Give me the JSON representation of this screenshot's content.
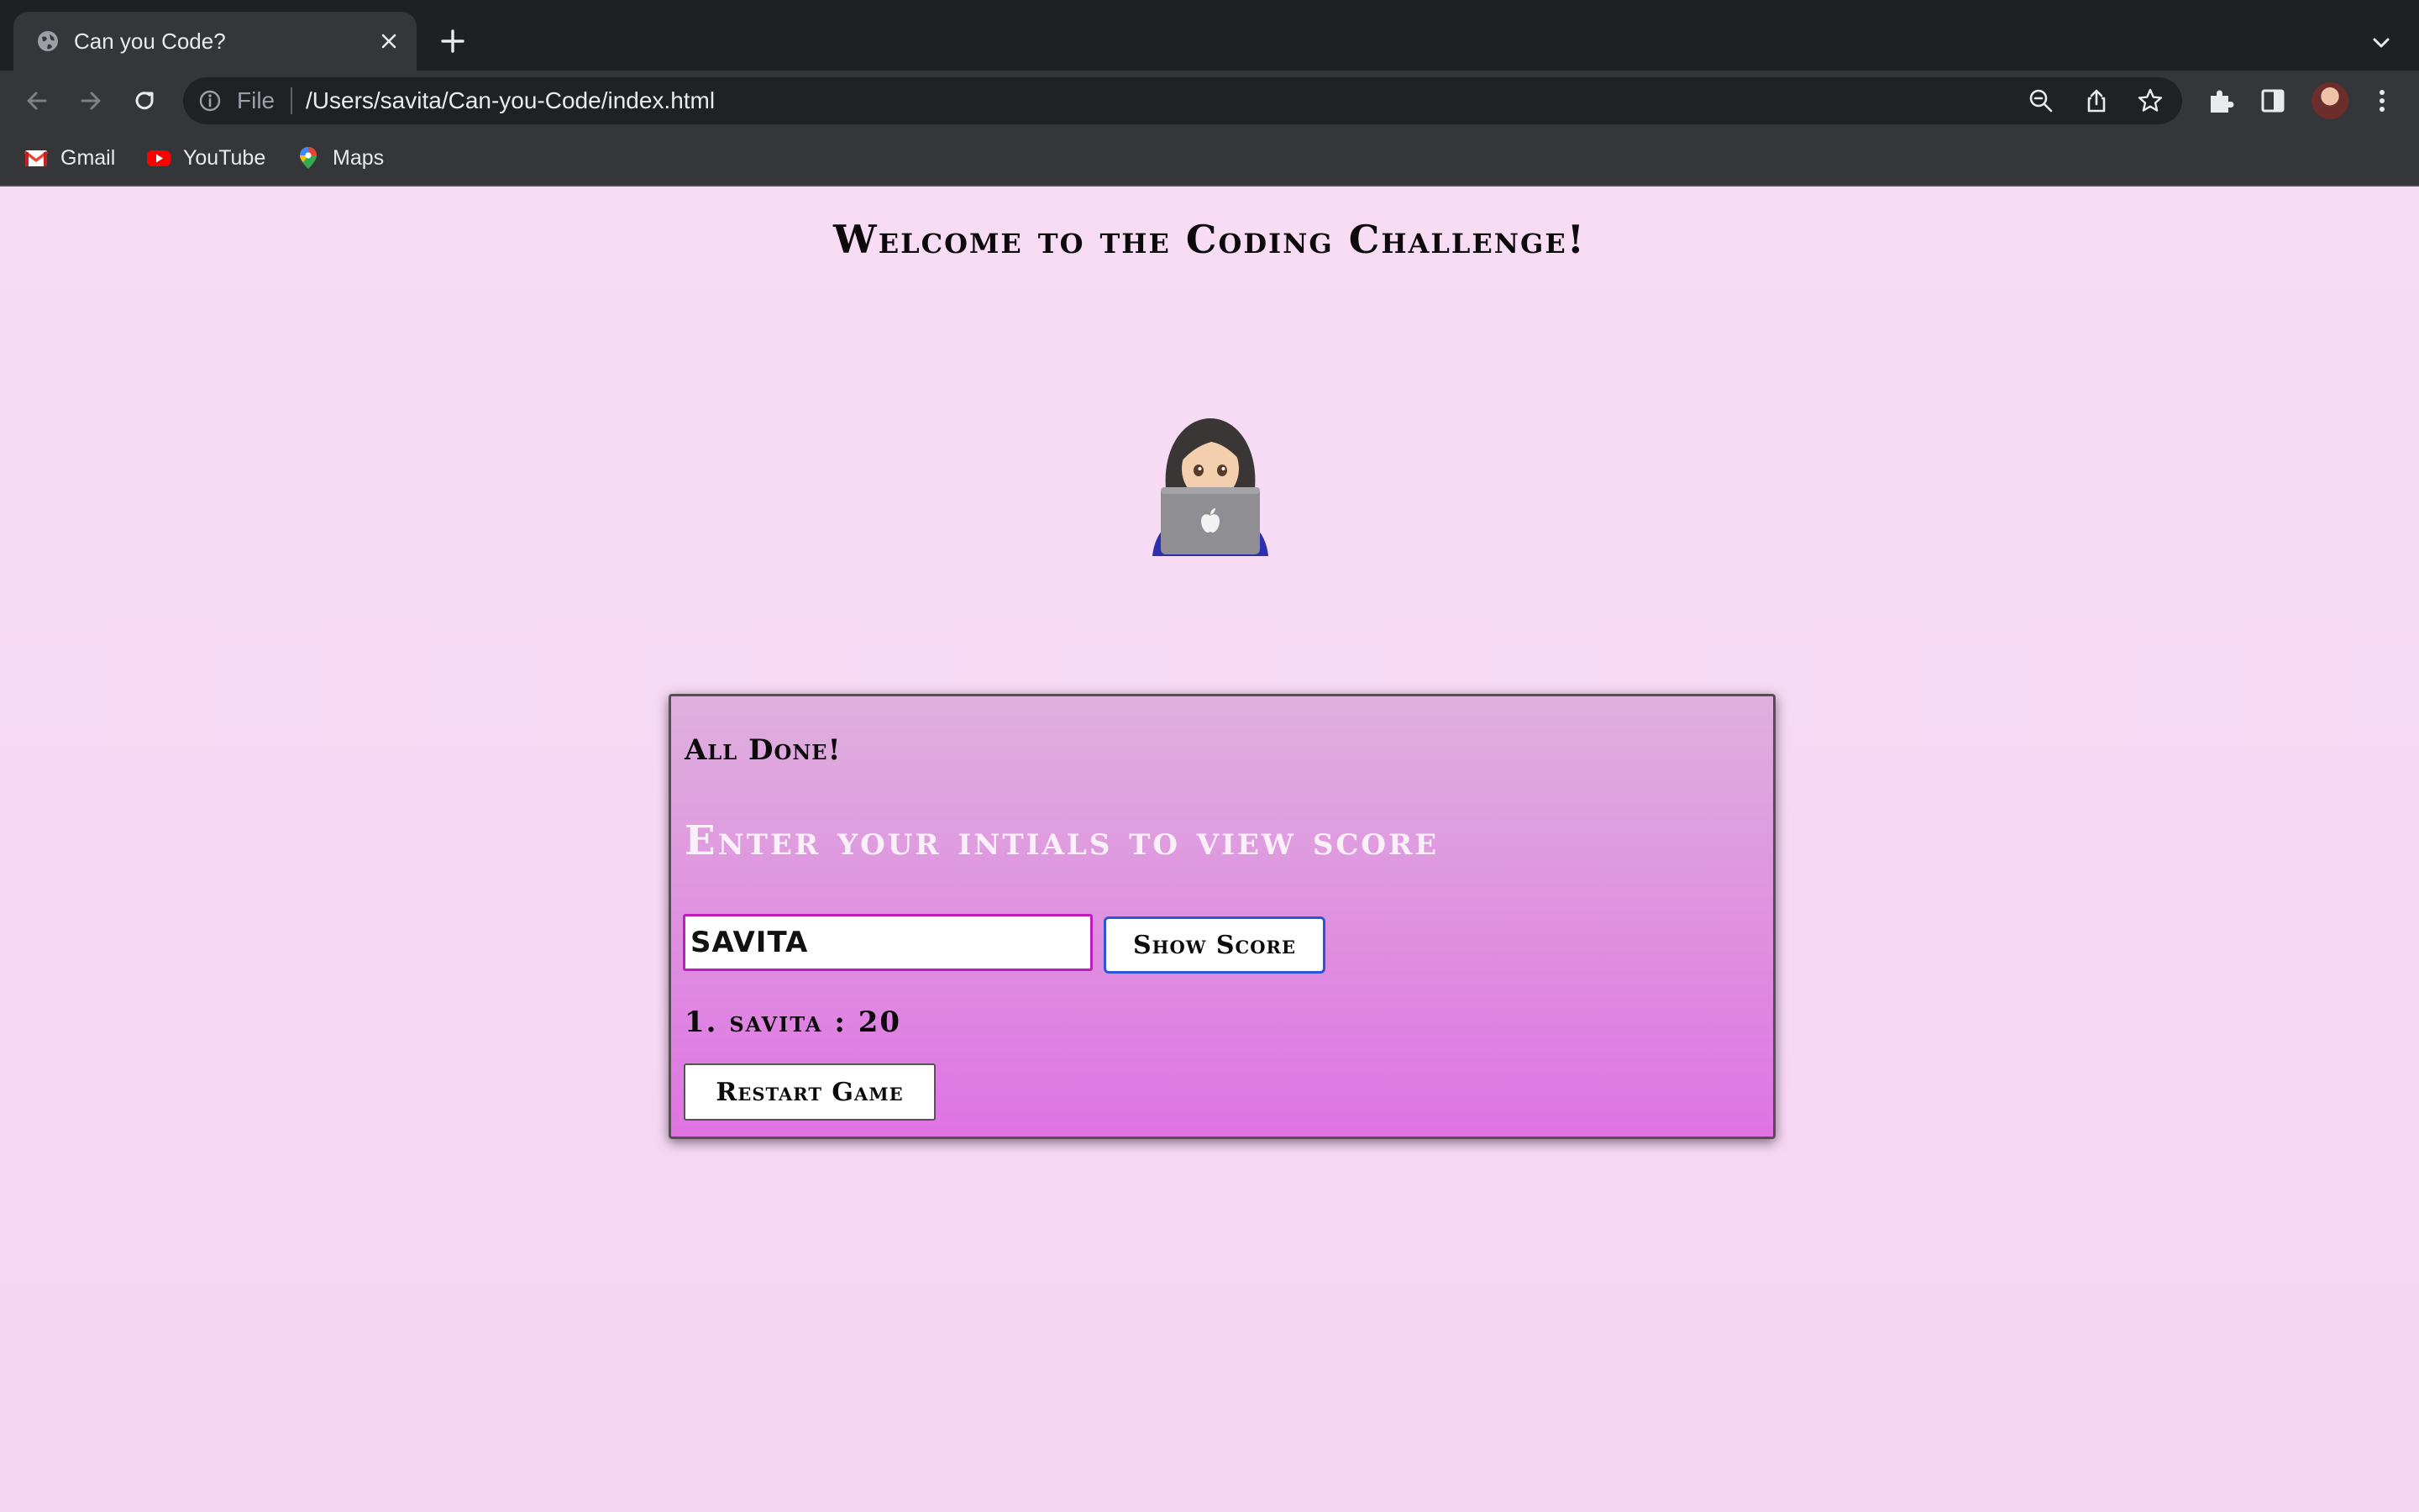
{
  "browser": {
    "tab": {
      "title": "Can you Code?",
      "favicon": "globe-icon"
    },
    "address_bar": {
      "scheme_label": "File",
      "url": "/Users/savita/Can-you-Code/index.html"
    },
    "bookmarks": [
      {
        "label": "Gmail",
        "icon": "gmail-icon"
      },
      {
        "label": "YouTube",
        "icon": "youtube-icon"
      },
      {
        "label": "Maps",
        "icon": "maps-icon"
      }
    ],
    "colors": {
      "tabbar": "#1f2023",
      "toolbar": "#35363a",
      "omnibox": "#202124"
    }
  },
  "page": {
    "title": "Welcome to the Coding Challenge!",
    "hero_icon": "woman-technologist-emoji",
    "card": {
      "heading": "All Done!",
      "prompt": "Enter your intials to view score",
      "initials_value": "SAVITA",
      "show_score_label": "Show Score",
      "scores": [
        "1. savita : 20"
      ],
      "restart_label": "Restart Game"
    },
    "colors": {
      "background": "#f6d6f3",
      "card_top": "#dfb0dd",
      "card_bottom": "#df74e3",
      "input_border": "#c01cc0",
      "button_focus_border": "#2b57d6"
    }
  }
}
